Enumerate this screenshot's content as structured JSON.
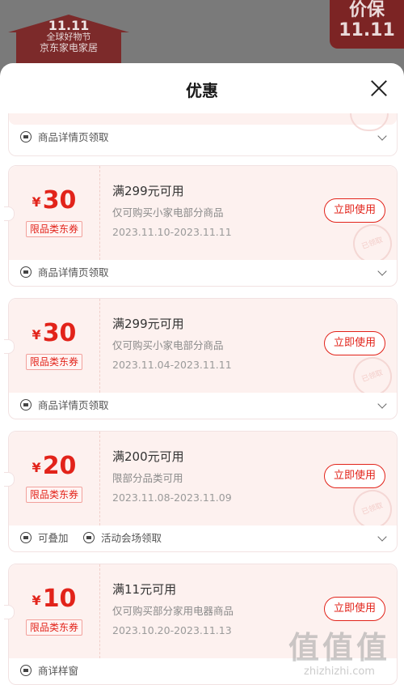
{
  "background": {
    "logo_top": "11.11",
    "logo_mid": "全球好物节",
    "logo_bottom": "京东家电家居",
    "right_badge_line1": "价保",
    "right_badge_line2": "11.11"
  },
  "header": {
    "title": "优惠"
  },
  "partial_card": {
    "footer_text": "商品详情页领取"
  },
  "coupons": [
    {
      "currency": "¥",
      "amount": "30",
      "tag": "限品类东券",
      "condition": "满299元可用",
      "description": "仅可购买小家电部分商品",
      "dates": "2023.11.10-2023.11.11",
      "button": "立即使用",
      "footer": [
        "商品详情页领取"
      ]
    },
    {
      "currency": "¥",
      "amount": "30",
      "tag": "限品类东券",
      "condition": "满299元可用",
      "description": "仅可购买小家电部分商品",
      "dates": "2023.11.04-2023.11.11",
      "button": "立即使用",
      "footer": [
        "商品详情页领取"
      ]
    },
    {
      "currency": "¥",
      "amount": "20",
      "tag": "限品类东券",
      "condition": "满200元可用",
      "description": "限部分品类可用",
      "dates": "2023.11.08-2023.11.09",
      "button": "立即使用",
      "footer": [
        "可叠加",
        "活动会场领取"
      ]
    },
    {
      "currency": "¥",
      "amount": "10",
      "tag": "限品类东券",
      "condition": "满11元可用",
      "description": "仅可购买部分家用电器商品",
      "dates": "2023.10.20-2023.11.13",
      "button": "立即使用",
      "footer": [
        "商详样窗"
      ]
    }
  ],
  "stamp_text": "已领取",
  "watermark": {
    "big": "值值值",
    "small": "zhizhizhi.com"
  },
  "colors": {
    "accent": "#e2231a",
    "coupon_bg": "#fdf1ef",
    "overlay": "#6b6b6b"
  }
}
